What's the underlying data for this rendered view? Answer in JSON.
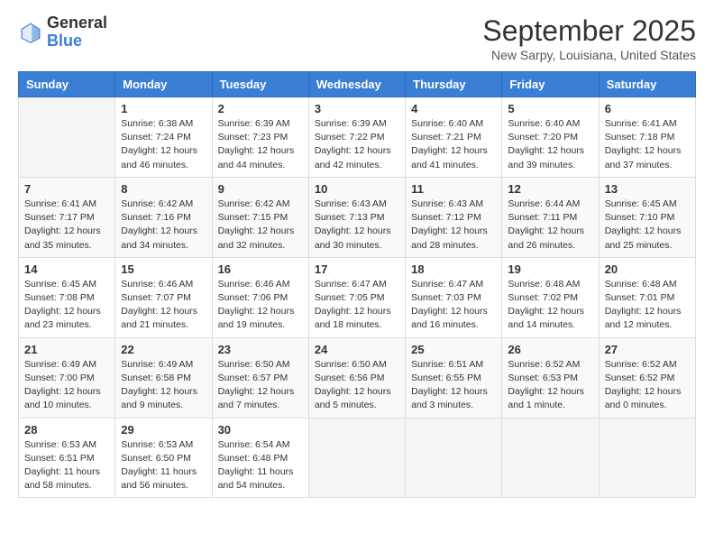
{
  "header": {
    "logo_general": "General",
    "logo_blue": "Blue",
    "title": "September 2025",
    "location": "New Sarpy, Louisiana, United States"
  },
  "days_of_week": [
    "Sunday",
    "Monday",
    "Tuesday",
    "Wednesday",
    "Thursday",
    "Friday",
    "Saturday"
  ],
  "weeks": [
    [
      {
        "day": null
      },
      {
        "day": "1",
        "sunrise": "6:38 AM",
        "sunset": "7:24 PM",
        "daylight": "12 hours and 46 minutes."
      },
      {
        "day": "2",
        "sunrise": "6:39 AM",
        "sunset": "7:23 PM",
        "daylight": "12 hours and 44 minutes."
      },
      {
        "day": "3",
        "sunrise": "6:39 AM",
        "sunset": "7:22 PM",
        "daylight": "12 hours and 42 minutes."
      },
      {
        "day": "4",
        "sunrise": "6:40 AM",
        "sunset": "7:21 PM",
        "daylight": "12 hours and 41 minutes."
      },
      {
        "day": "5",
        "sunrise": "6:40 AM",
        "sunset": "7:20 PM",
        "daylight": "12 hours and 39 minutes."
      },
      {
        "day": "6",
        "sunrise": "6:41 AM",
        "sunset": "7:18 PM",
        "daylight": "12 hours and 37 minutes."
      }
    ],
    [
      {
        "day": "7",
        "sunrise": "6:41 AM",
        "sunset": "7:17 PM",
        "daylight": "12 hours and 35 minutes."
      },
      {
        "day": "8",
        "sunrise": "6:42 AM",
        "sunset": "7:16 PM",
        "daylight": "12 hours and 34 minutes."
      },
      {
        "day": "9",
        "sunrise": "6:42 AM",
        "sunset": "7:15 PM",
        "daylight": "12 hours and 32 minutes."
      },
      {
        "day": "10",
        "sunrise": "6:43 AM",
        "sunset": "7:13 PM",
        "daylight": "12 hours and 30 minutes."
      },
      {
        "day": "11",
        "sunrise": "6:43 AM",
        "sunset": "7:12 PM",
        "daylight": "12 hours and 28 minutes."
      },
      {
        "day": "12",
        "sunrise": "6:44 AM",
        "sunset": "7:11 PM",
        "daylight": "12 hours and 26 minutes."
      },
      {
        "day": "13",
        "sunrise": "6:45 AM",
        "sunset": "7:10 PM",
        "daylight": "12 hours and 25 minutes."
      }
    ],
    [
      {
        "day": "14",
        "sunrise": "6:45 AM",
        "sunset": "7:08 PM",
        "daylight": "12 hours and 23 minutes."
      },
      {
        "day": "15",
        "sunrise": "6:46 AM",
        "sunset": "7:07 PM",
        "daylight": "12 hours and 21 minutes."
      },
      {
        "day": "16",
        "sunrise": "6:46 AM",
        "sunset": "7:06 PM",
        "daylight": "12 hours and 19 minutes."
      },
      {
        "day": "17",
        "sunrise": "6:47 AM",
        "sunset": "7:05 PM",
        "daylight": "12 hours and 18 minutes."
      },
      {
        "day": "18",
        "sunrise": "6:47 AM",
        "sunset": "7:03 PM",
        "daylight": "12 hours and 16 minutes."
      },
      {
        "day": "19",
        "sunrise": "6:48 AM",
        "sunset": "7:02 PM",
        "daylight": "12 hours and 14 minutes."
      },
      {
        "day": "20",
        "sunrise": "6:48 AM",
        "sunset": "7:01 PM",
        "daylight": "12 hours and 12 minutes."
      }
    ],
    [
      {
        "day": "21",
        "sunrise": "6:49 AM",
        "sunset": "7:00 PM",
        "daylight": "12 hours and 10 minutes."
      },
      {
        "day": "22",
        "sunrise": "6:49 AM",
        "sunset": "6:58 PM",
        "daylight": "12 hours and 9 minutes."
      },
      {
        "day": "23",
        "sunrise": "6:50 AM",
        "sunset": "6:57 PM",
        "daylight": "12 hours and 7 minutes."
      },
      {
        "day": "24",
        "sunrise": "6:50 AM",
        "sunset": "6:56 PM",
        "daylight": "12 hours and 5 minutes."
      },
      {
        "day": "25",
        "sunrise": "6:51 AM",
        "sunset": "6:55 PM",
        "daylight": "12 hours and 3 minutes."
      },
      {
        "day": "26",
        "sunrise": "6:52 AM",
        "sunset": "6:53 PM",
        "daylight": "12 hours and 1 minute."
      },
      {
        "day": "27",
        "sunrise": "6:52 AM",
        "sunset": "6:52 PM",
        "daylight": "12 hours and 0 minutes."
      }
    ],
    [
      {
        "day": "28",
        "sunrise": "6:53 AM",
        "sunset": "6:51 PM",
        "daylight": "11 hours and 58 minutes."
      },
      {
        "day": "29",
        "sunrise": "6:53 AM",
        "sunset": "6:50 PM",
        "daylight": "11 hours and 56 minutes."
      },
      {
        "day": "30",
        "sunrise": "6:54 AM",
        "sunset": "6:48 PM",
        "daylight": "11 hours and 54 minutes."
      },
      {
        "day": null
      },
      {
        "day": null
      },
      {
        "day": null
      },
      {
        "day": null
      }
    ]
  ]
}
